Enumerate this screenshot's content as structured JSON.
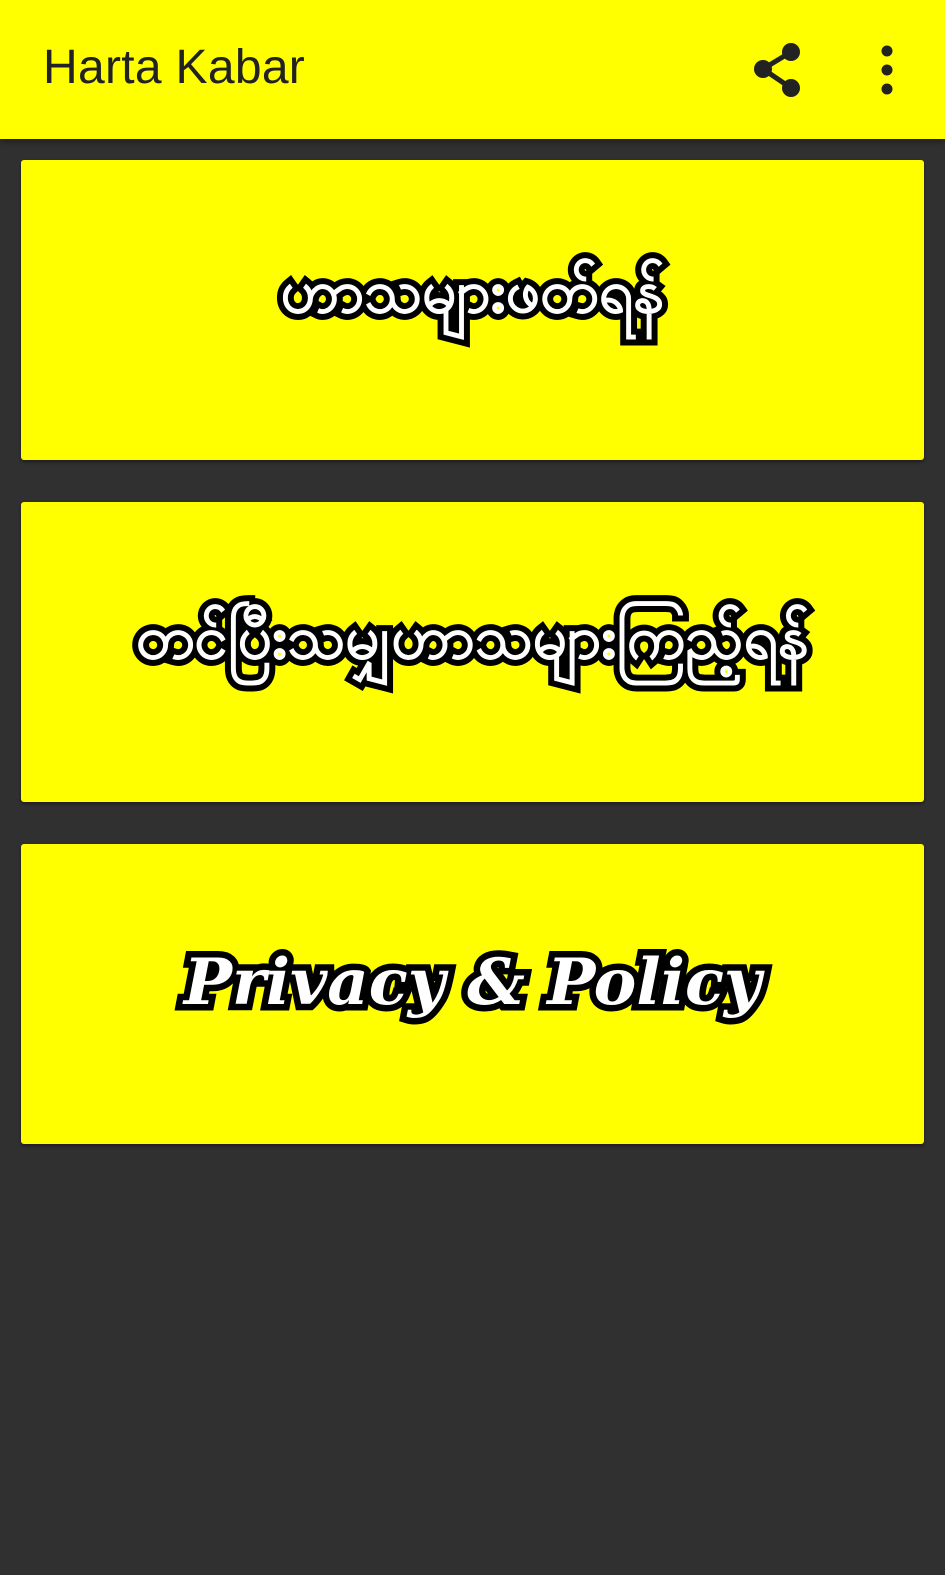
{
  "appbar": {
    "title": "Harta Kabar",
    "actions": [
      {
        "name": "share",
        "icon": "share-icon"
      },
      {
        "name": "more",
        "icon": "more-vert-icon"
      }
    ]
  },
  "menu": {
    "items": [
      {
        "label": "ဟာသများဖတ်ရန်"
      },
      {
        "label": "တင်ပြီးသမျှဟာသများကြည့်ရန်"
      },
      {
        "label": "Privacy & Policy"
      }
    ]
  },
  "colors": {
    "accent": "#ffff00",
    "background": "#303030",
    "title_text": "#222222",
    "label_fill": "#ffffff",
    "label_stroke": "#000000"
  }
}
